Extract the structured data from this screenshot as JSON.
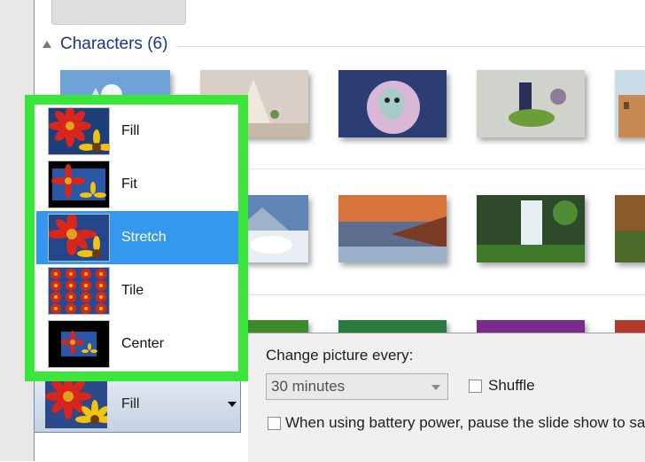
{
  "group": {
    "title": "Characters (6)"
  },
  "position_menu": {
    "options": [
      {
        "label": "Fill",
        "selected": false
      },
      {
        "label": "Fit",
        "selected": false
      },
      {
        "label": "Stretch",
        "selected": true
      },
      {
        "label": "Tile",
        "selected": false
      },
      {
        "label": "Center",
        "selected": false
      }
    ]
  },
  "picture_position": {
    "value": "Fill"
  },
  "slideshow": {
    "change_label": "Change picture every:",
    "interval": "30 minutes",
    "shuffle_label": "Shuffle",
    "battery_label": "When using battery power, pause the slide show to save"
  },
  "colors": {
    "highlight": "#3398ee",
    "callout": "#39e639",
    "group_title": "#1e3287"
  }
}
